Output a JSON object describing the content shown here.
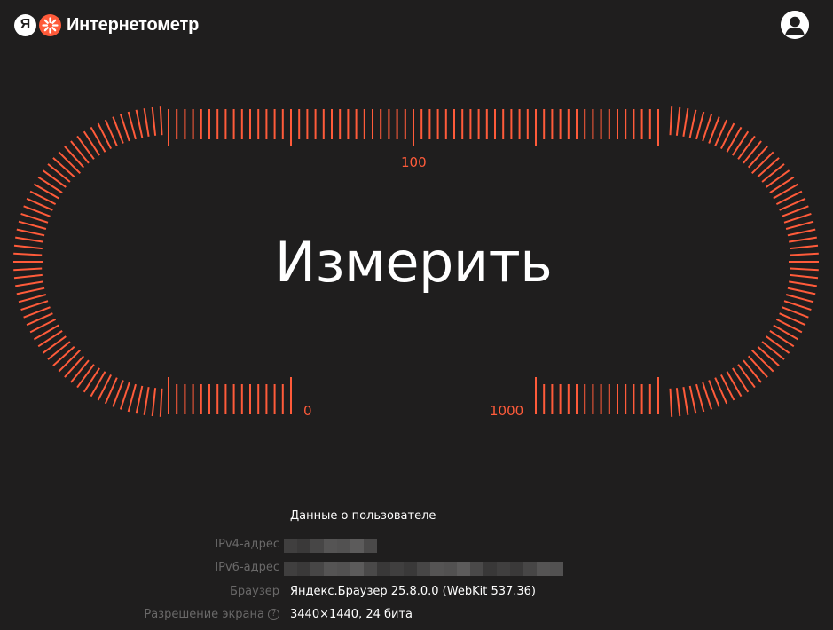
{
  "header": {
    "logo_letter": "Я",
    "service_name": "Интернетометр"
  },
  "gauge": {
    "button_label": "Измерить",
    "labels": {
      "top": "100",
      "bottom_left": "0",
      "bottom_right": "1000"
    },
    "tick_color": "#ff5b3a"
  },
  "user_info": {
    "title": "Данные о пользователе",
    "rows": [
      {
        "label": "IPv4-адрес",
        "value": ""
      },
      {
        "label": "IPv6-адрес",
        "value": ""
      },
      {
        "label": "Браузер",
        "value": "Яндекс.Браузер 25.8.0.0 (WebKit 537.36)"
      },
      {
        "label": "Разрешение экрана",
        "value": "3440×1440, 24 бита"
      }
    ]
  },
  "colors": {
    "background": "#1f1e1e",
    "accent": "#ff5b3a",
    "muted_text": "#6a6969"
  }
}
